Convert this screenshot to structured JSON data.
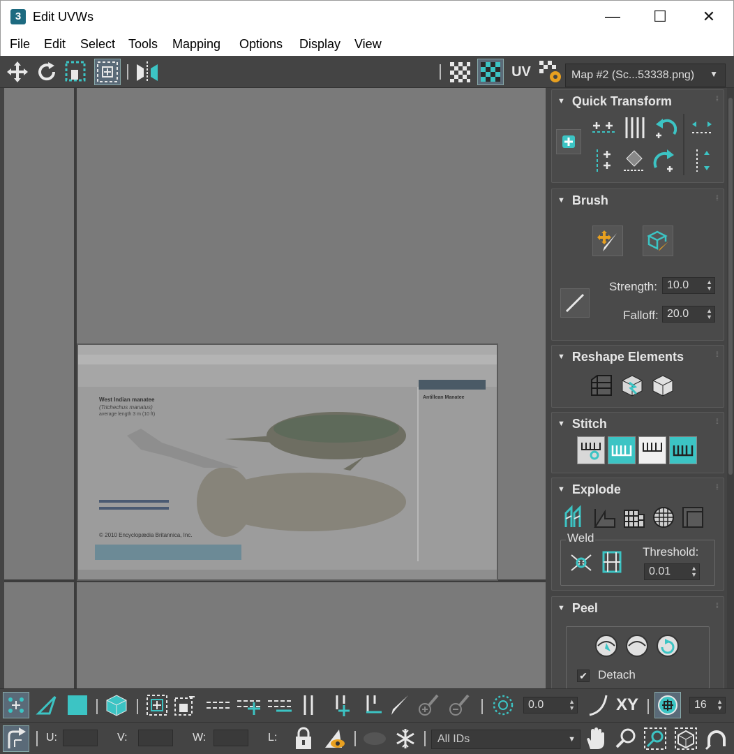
{
  "window": {
    "title": "Edit UVWs",
    "app_icon_text": "3"
  },
  "window_controls": {
    "minimize": "—",
    "maximize": "☐",
    "close": "✕"
  },
  "menu": [
    "File",
    "Edit",
    "Select",
    "Tools",
    "Mapping",
    "Options",
    "Display",
    "View"
  ],
  "toolbar": {
    "uv_label": "UV",
    "map_select": "Map #2 (Sc...53338.png)"
  },
  "panel": {
    "quick_transform": {
      "title": "Quick Transform"
    },
    "brush": {
      "title": "Brush",
      "strength_label": "Strength:",
      "strength_value": "10.0",
      "falloff_label": "Falloff:",
      "falloff_value": "20.0"
    },
    "reshape": {
      "title": "Reshape Elements"
    },
    "stitch": {
      "title": "Stitch"
    },
    "explode": {
      "title": "Explode",
      "weld_label": "Weld",
      "threshold_label": "Threshold:",
      "threshold_value": "0.01"
    },
    "peel": {
      "title": "Peel",
      "detach_label": "Detach"
    }
  },
  "bottom": {
    "angle_value": "0.0",
    "xy_label": "XY",
    "snap_value": "16",
    "u_label": "U:",
    "v_label": "V:",
    "w_label": "W:",
    "l_label": "L:",
    "ids_select": "All IDs"
  },
  "texture": {
    "heading": "West Indian manatee",
    "subheading": "(Trichechus manatus)",
    "caption": "average length 3 m (10 ft)",
    "copyright": "© 2010 Encyclopædia Britannica, Inc.",
    "side_title": "Antillean Manatee"
  },
  "colors": {
    "accent": "#3cc4c4",
    "viewport": "#7a7a7a",
    "panel": "#444444"
  }
}
